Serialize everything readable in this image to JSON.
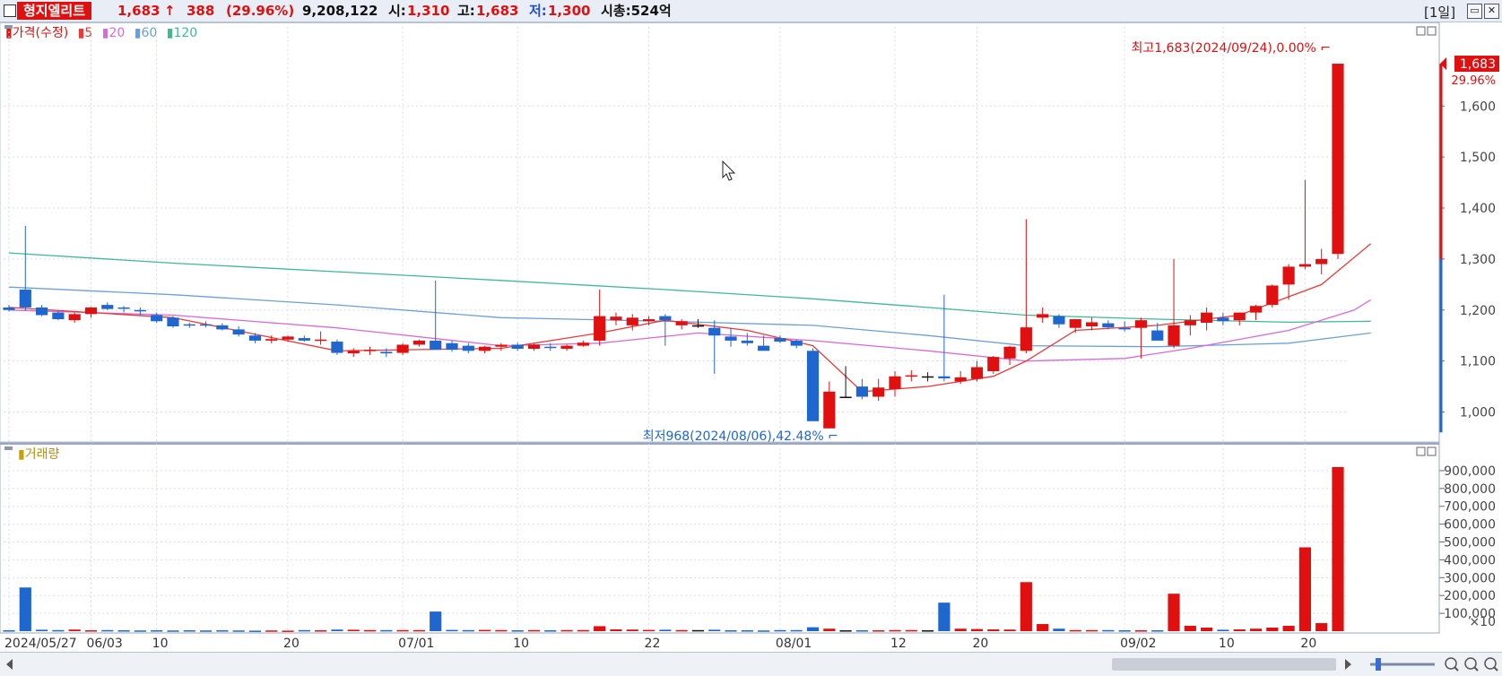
{
  "header": {
    "stock_name": "형지엘리트",
    "price": "1,683",
    "arrow": "↑",
    "change": "388",
    "change_pct": "(29.96%)",
    "volume": "9,208,122",
    "open_label": "시:",
    "open": "1,310",
    "high_label": "고:",
    "high": "1,683",
    "low_label": "저:",
    "low": "1,300",
    "mcap": "시총:524억",
    "period": "[1일]",
    "win_min": "▭",
    "win_close": "✕"
  },
  "legend_price": {
    "label": "가격(수정)",
    "ma5": "5",
    "ma20": "20",
    "ma60": "60",
    "ma120": "120"
  },
  "legend_volume": {
    "label": "거래량"
  },
  "colors": {
    "up": "#e01010",
    "down": "#1f66cf",
    "ma5": "#e83a3a",
    "ma20": "#d76ad7",
    "ma60": "#6aa0d8",
    "ma120": "#3fb894",
    "grid": "#d8dde6"
  },
  "chart_data": [
    {
      "type": "candlestick",
      "title": "가격(수정)",
      "ylim": [
        950,
        1720
      ],
      "y_ticks": [
        "1,000",
        "1,100",
        "1,200",
        "1,300",
        "1,400",
        "1,500",
        "1,600"
      ],
      "x_tick_labels": [
        "2024/05/27",
        "06/03",
        "10",
        "20",
        "07/01",
        "10",
        "22",
        "08/01",
        "12",
        "20",
        "09/02",
        "10",
        "20"
      ],
      "x_tick_index": [
        0,
        5,
        9,
        17,
        24,
        31,
        39,
        47,
        54,
        59,
        68,
        74,
        79
      ],
      "current_price_label": "1,683",
      "current_pct_label": "29.96%",
      "high_annotation": "최고1,683(2024/09/24),0.00%",
      "low_annotation": "최저968(2024/08/06),42.48%",
      "ohlc": [
        [
          1205,
          1210,
          1197,
          1200
        ],
        [
          1240,
          1365,
          1198,
          1205
        ],
        [
          1205,
          1210,
          1188,
          1190
        ],
        [
          1195,
          1198,
          1180,
          1182
        ],
        [
          1180,
          1195,
          1175,
          1192
        ],
        [
          1192,
          1206,
          1185,
          1205
        ],
        [
          1210,
          1215,
          1200,
          1202
        ],
        [
          1205,
          1208,
          1195,
          1203
        ],
        [
          1200,
          1205,
          1190,
          1198
        ],
        [
          1190,
          1195,
          1175,
          1178
        ],
        [
          1185,
          1188,
          1165,
          1168
        ],
        [
          1172,
          1175,
          1165,
          1170
        ],
        [
          1172,
          1178,
          1166,
          1170
        ],
        [
          1170,
          1174,
          1160,
          1162
        ],
        [
          1162,
          1168,
          1148,
          1152
        ],
        [
          1150,
          1155,
          1135,
          1140
        ],
        [
          1140,
          1150,
          1135,
          1143
        ],
        [
          1142,
          1150,
          1138,
          1148
        ],
        [
          1145,
          1150,
          1138,
          1140
        ],
        [
          1140,
          1158,
          1132,
          1142
        ],
        [
          1138,
          1142,
          1112,
          1116
        ],
        [
          1115,
          1125,
          1108,
          1120
        ],
        [
          1120,
          1128,
          1112,
          1122
        ],
        [
          1118,
          1125,
          1108,
          1115
        ],
        [
          1116,
          1135,
          1112,
          1132
        ],
        [
          1132,
          1142,
          1128,
          1140
        ],
        [
          1140,
          1258,
          1130,
          1122
        ],
        [
          1135,
          1140,
          1118,
          1122
        ],
        [
          1130,
          1135,
          1115,
          1120
        ],
        [
          1120,
          1130,
          1115,
          1128
        ],
        [
          1128,
          1135,
          1120,
          1132
        ],
        [
          1132,
          1136,
          1120,
          1124
        ],
        [
          1124,
          1134,
          1120,
          1132
        ],
        [
          1128,
          1135,
          1120,
          1126
        ],
        [
          1124,
          1132,
          1120,
          1130
        ],
        [
          1130,
          1140,
          1128,
          1136
        ],
        [
          1140,
          1240,
          1130,
          1188
        ],
        [
          1180,
          1195,
          1170,
          1187
        ],
        [
          1170,
          1192,
          1160,
          1185
        ],
        [
          1178,
          1188,
          1170,
          1182
        ],
        [
          1188,
          1192,
          1130,
          1180
        ],
        [
          1170,
          1182,
          1162,
          1178
        ],
        [
          1170,
          1182,
          1165,
          1170
        ],
        [
          1165,
          1180,
          1075,
          1150
        ],
        [
          1148,
          1165,
          1128,
          1140
        ],
        [
          1140,
          1155,
          1130,
          1135
        ],
        [
          1130,
          1150,
          1122,
          1120
        ],
        [
          1145,
          1150,
          1135,
          1138
        ],
        [
          1140,
          1142,
          1125,
          1130
        ],
        [
          1120,
          1125,
          1020,
          982
        ],
        [
          968,
          1060,
          968,
          1040
        ],
        [
          1030,
          1090,
          1030,
          1030
        ],
        [
          1050,
          1065,
          1025,
          1030
        ],
        [
          1030,
          1065,
          1022,
          1048
        ],
        [
          1045,
          1080,
          1030,
          1070
        ],
        [
          1070,
          1082,
          1060,
          1072
        ],
        [
          1070,
          1078,
          1060,
          1070
        ],
        [
          1070,
          1230,
          1060,
          1066
        ],
        [
          1060,
          1080,
          1055,
          1068
        ],
        [
          1065,
          1100,
          1060,
          1088
        ],
        [
          1080,
          1110,
          1075,
          1108
        ],
        [
          1105,
          1130,
          1092,
          1128
        ],
        [
          1120,
          1378,
          1115,
          1166
        ],
        [
          1185,
          1205,
          1175,
          1192
        ],
        [
          1188,
          1192,
          1165,
          1172
        ],
        [
          1165,
          1180,
          1155,
          1182
        ],
        [
          1168,
          1185,
          1160,
          1176
        ],
        [
          1174,
          1180,
          1162,
          1166
        ],
        [
          1165,
          1178,
          1158,
          1162
        ],
        [
          1165,
          1185,
          1105,
          1180
        ],
        [
          1160,
          1175,
          1140,
          1140
        ],
        [
          1130,
          1300,
          1125,
          1170
        ],
        [
          1170,
          1190,
          1150,
          1180
        ],
        [
          1175,
          1205,
          1160,
          1195
        ],
        [
          1185,
          1195,
          1170,
          1178
        ],
        [
          1180,
          1195,
          1170,
          1195
        ],
        [
          1195,
          1210,
          1180,
          1208
        ],
        [
          1210,
          1250,
          1205,
          1248
        ],
        [
          1250,
          1290,
          1220,
          1285
        ],
        [
          1285,
          1455,
          1280,
          1290
        ],
        [
          1290,
          1320,
          1270,
          1300
        ],
        [
          1310,
          1683,
          1300,
          1683
        ]
      ],
      "ma5": [
        [
          0,
          1205
        ],
        [
          10,
          1185
        ],
        [
          20,
          1120
        ],
        [
          30,
          1125
        ],
        [
          36,
          1155
        ],
        [
          40,
          1180
        ],
        [
          45,
          1160
        ],
        [
          49,
          1130
        ],
        [
          52,
          1040
        ],
        [
          56,
          1050
        ],
        [
          60,
          1070
        ],
        [
          62,
          1100
        ],
        [
          65,
          1160
        ],
        [
          70,
          1170
        ],
        [
          75,
          1190
        ],
        [
          80,
          1250
        ],
        [
          83,
          1330
        ]
      ],
      "ma20": [
        [
          0,
          1200
        ],
        [
          10,
          1190
        ],
        [
          20,
          1165
        ],
        [
          30,
          1130
        ],
        [
          36,
          1135
        ],
        [
          42,
          1155
        ],
        [
          49,
          1140
        ],
        [
          56,
          1120
        ],
        [
          62,
          1100
        ],
        [
          68,
          1105
        ],
        [
          72,
          1125
        ],
        [
          78,
          1160
        ],
        [
          82,
          1200
        ],
        [
          83,
          1220
        ]
      ],
      "ma60": [
        [
          0,
          1245
        ],
        [
          10,
          1230
        ],
        [
          20,
          1210
        ],
        [
          30,
          1185
        ],
        [
          40,
          1178
        ],
        [
          49,
          1170
        ],
        [
          56,
          1150
        ],
        [
          62,
          1130
        ],
        [
          70,
          1128
        ],
        [
          78,
          1135
        ],
        [
          83,
          1155
        ]
      ],
      "ma120": [
        [
          0,
          1312
        ],
        [
          10,
          1292
        ],
        [
          20,
          1275
        ],
        [
          30,
          1258
        ],
        [
          40,
          1240
        ],
        [
          49,
          1222
        ],
        [
          56,
          1205
        ],
        [
          62,
          1190
        ],
        [
          70,
          1182
        ],
        [
          78,
          1176
        ],
        [
          83,
          1178
        ]
      ]
    },
    {
      "type": "bar",
      "title": "거래량",
      "ylim": [
        0,
        950000
      ],
      "y_ticks": [
        "100,000",
        "200,000",
        "300,000",
        "400,000",
        "500,000",
        "600,000",
        "700,000",
        "800,000",
        "900,000"
      ],
      "y_unit": "×10",
      "values": [
        5000,
        245000,
        8000,
        6000,
        9000,
        5000,
        6000,
        5000,
        4000,
        5000,
        4000,
        5000,
        4000,
        5000,
        4000,
        3000,
        4000,
        3000,
        6000,
        5000,
        9000,
        8000,
        6000,
        6000,
        6000,
        6000,
        110000,
        7000,
        6000,
        7000,
        6000,
        5000,
        6000,
        5000,
        6000,
        6000,
        28000,
        10000,
        9000,
        7000,
        8000,
        6000,
        6000,
        8000,
        5000,
        5000,
        4000,
        6000,
        6000,
        22000,
        14000,
        5000,
        5000,
        5000,
        6000,
        6000,
        5000,
        160000,
        14000,
        12000,
        10000,
        9000,
        275000,
        40000,
        14000,
        6000,
        6000,
        6000,
        5000,
        5000,
        5000,
        210000,
        30000,
        20000,
        8000,
        10000,
        14000,
        20000,
        30000,
        470000,
        45000,
        920000
      ],
      "colors_up_down": "candle"
    }
  ]
}
